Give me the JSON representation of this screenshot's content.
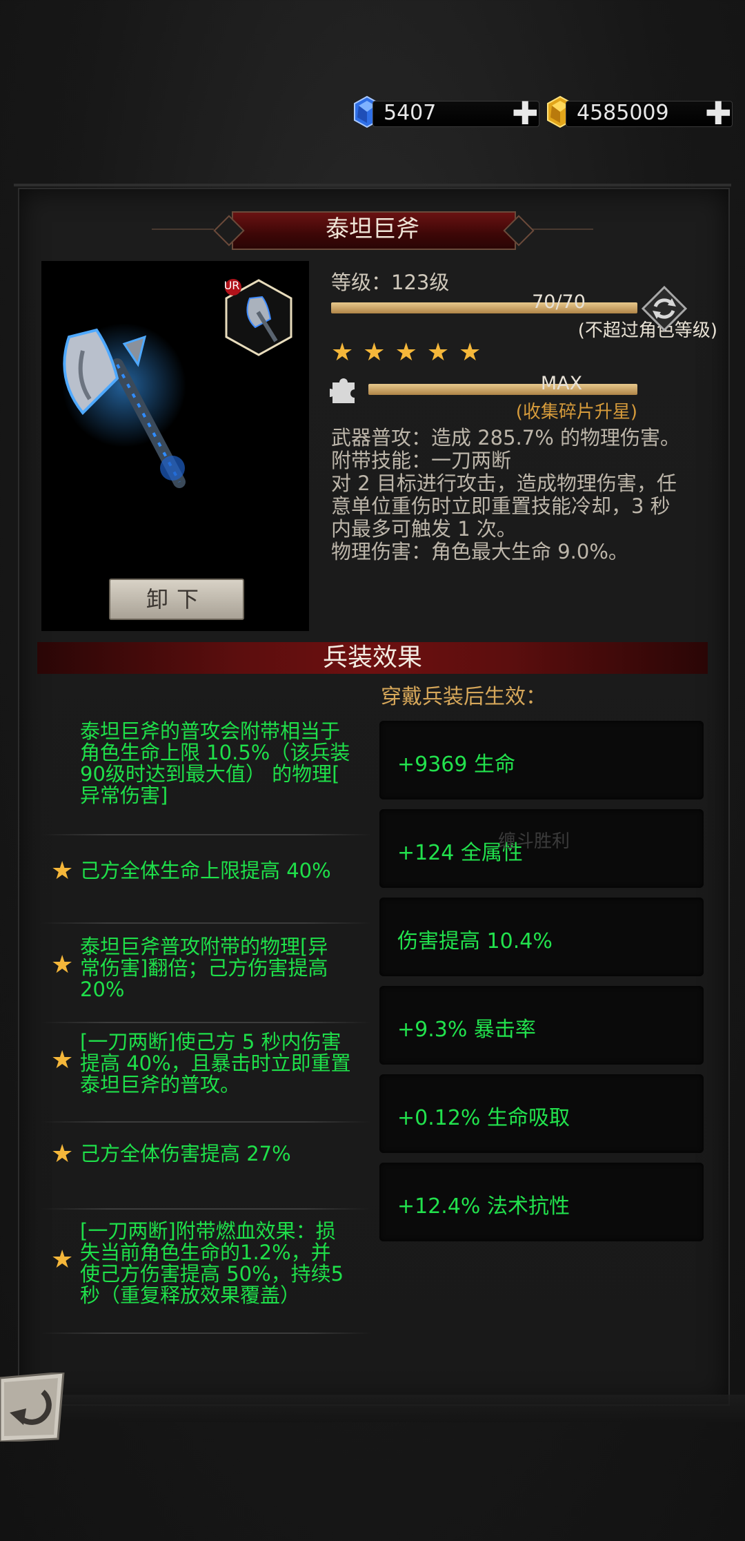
{
  "currency": {
    "gems": "5407",
    "gold": "4585009",
    "plus_label": "✚"
  },
  "weapon": {
    "name": "泰坦巨斧",
    "rarity_badge": "UR",
    "level_label": "等级：123级",
    "level_bar_text": "70/70",
    "level_bar_fill": 1.0,
    "level_note": "(不超过角色等级)",
    "stars": 5,
    "star_glyph": "★",
    "shard_bar_text": "MAX",
    "shard_bar_fill": 1.0,
    "shard_note": "(收集碎片升星)",
    "description": [
      "武器普攻：造成 285.7% 的物理伤害。",
      "附带技能：一刀两断",
      "对 2 目标进行攻击，造成物理伤害，任",
      "意单位重伤时立即重置技能冷却，3 秒",
      "内最多可触发 1 次。",
      "物理伤害：角色最大生命 9.0%。"
    ],
    "unequip_label": "卸下"
  },
  "effects": {
    "section_title": "兵装效果",
    "wear_header": "穿戴兵装后生效：",
    "ghost_text": "缠斗胜利",
    "left": [
      {
        "star": false,
        "lines": [
          "泰坦巨斧的普攻会附带相当于",
          "角色生命上限 10.5%（该兵装",
          "90级时达到最大值） 的物理[",
          "异常伤害]"
        ]
      },
      {
        "star": true,
        "lines": [
          "己方全体生命上限提高 40%"
        ]
      },
      {
        "star": true,
        "lines": [
          "泰坦巨斧普攻附带的物理[异",
          "常伤害]翻倍；己方伤害提高",
          "20%"
        ]
      },
      {
        "star": true,
        "lines": [
          "[一刀两断]使己方 5 秒内伤害",
          "提高 40%，且暴击时立即重置",
          "泰坦巨斧的普攻。"
        ]
      },
      {
        "star": true,
        "lines": [
          "己方全体伤害提高 27%"
        ]
      },
      {
        "star": true,
        "lines": [
          "[一刀两断]附带燃血效果：损",
          "失当前角色生命的1.2%，并",
          "使己方伤害提高 50%，持续5",
          "秒（重复释放效果覆盖）"
        ]
      }
    ],
    "right": [
      "+9369 生命",
      "+124 全属性",
      "伤害提高 10.4%",
      "+9.3% 暴击率",
      "+0.12% 生命吸取",
      "+12.4% 法术抗性"
    ]
  },
  "colors": {
    "effect_green": "#1fe04a",
    "star_gold": "#f5b73a",
    "header_gold": "#d6a75a",
    "title_red": "#6a1212"
  }
}
